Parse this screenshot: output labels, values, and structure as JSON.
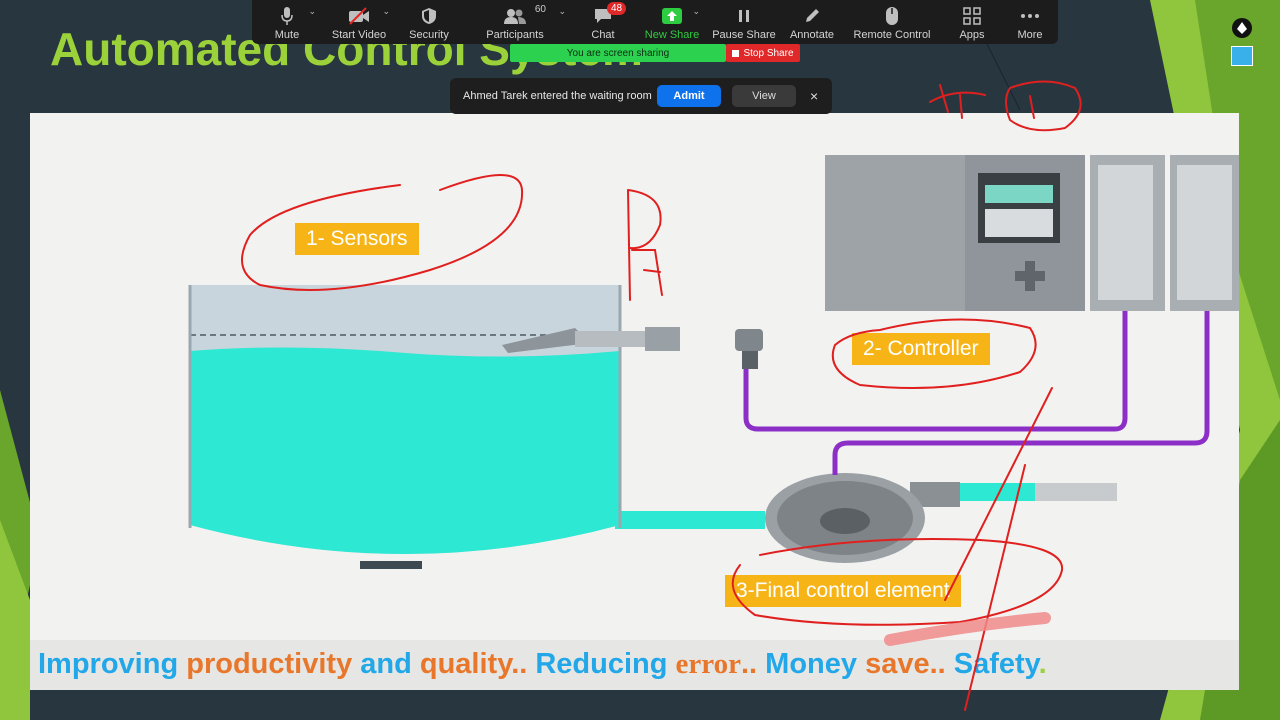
{
  "slide": {
    "title": "Automated Control System",
    "labels": {
      "sensors": "1- Sensors",
      "controller": "2- Controller",
      "final_element": "3-Final control element"
    },
    "bottom_line": [
      {
        "text": "Improving ",
        "color": "blue"
      },
      {
        "text": "productivity ",
        "color": "orange"
      },
      {
        "text": "and ",
        "color": "blue"
      },
      {
        "text": "quality",
        "color": "orange"
      },
      {
        "text": "..  ",
        "color": "orange"
      },
      {
        "text": "Reducing ",
        "color": "blue"
      },
      {
        "text": "error",
        "color": "orange",
        "serif": true
      },
      {
        "text": "..  ",
        "color": "orange"
      },
      {
        "text": "Money ",
        "color": "blue"
      },
      {
        "text": "save",
        "color": "orange"
      },
      {
        "text": "..  ",
        "color": "orange"
      },
      {
        "text": "Safety",
        "color": "blue"
      },
      {
        "text": ".",
        "color": "green"
      }
    ],
    "colors": {
      "title": "#9bd23a",
      "label_bg": "#f6b417",
      "water": "#2de8d2",
      "wire": "#8c2fc7",
      "ink": "#e0201f"
    }
  },
  "zoom_toolbar": {
    "items": [
      {
        "name": "mute",
        "label": "Mute",
        "icon": "microphone-icon",
        "caret": true
      },
      {
        "name": "start-video",
        "label": "Start Video",
        "icon": "video-off-icon",
        "caret": true
      },
      {
        "name": "security",
        "label": "Security",
        "icon": "shield-icon"
      },
      {
        "name": "participants",
        "label": "Participants",
        "icon": "people-icon",
        "caret": true,
        "count": "60"
      },
      {
        "name": "chat",
        "label": "Chat",
        "icon": "chat-bubble-icon",
        "badge": "48"
      },
      {
        "name": "new-share",
        "label": "New Share",
        "icon": "share-arrow-icon",
        "caret": true
      },
      {
        "name": "pause-share",
        "label": "Pause Share",
        "icon": "pause-icon"
      },
      {
        "name": "annotate",
        "label": "Annotate",
        "icon": "pencil-icon"
      },
      {
        "name": "remote-control",
        "label": "Remote Control",
        "icon": "mouse-icon"
      },
      {
        "name": "apps",
        "label": "Apps",
        "icon": "apps-grid-icon"
      },
      {
        "name": "more",
        "label": "More",
        "icon": "ellipsis-icon"
      }
    ],
    "sharing_banner": "You are screen sharing",
    "stop_share": "Stop Share"
  },
  "waiting_room": {
    "message": "Ahmed Tarek entered the waiting room",
    "admit": "Admit",
    "view": "View",
    "close": "×"
  }
}
